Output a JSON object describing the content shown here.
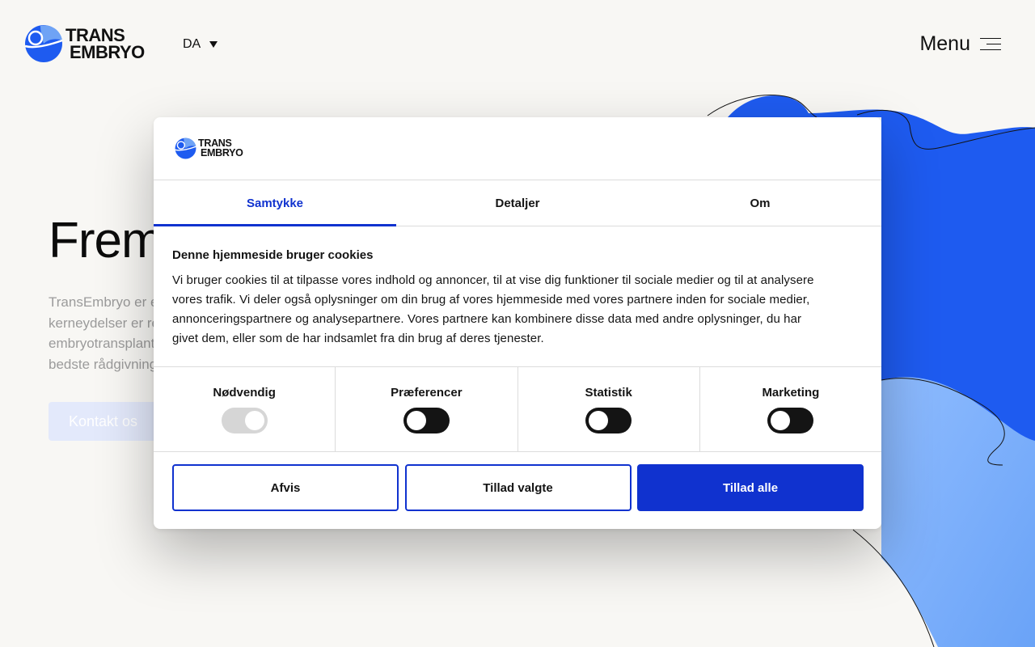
{
  "brand": {
    "logo_line1": "TRANS",
    "logo_line2": "EMBRYO",
    "primary_color": "#1032cf",
    "logo_blue": "#1e5bf0",
    "logo_light_blue": "#6fa3f5"
  },
  "header": {
    "language": "DA",
    "menu_label": "Menu"
  },
  "hero": {
    "title": "Frem",
    "text_lines": [
      "TransEmbryo er e",
      "kerneydelser er re",
      "embryotransplant",
      "bedste rådgivning"
    ],
    "cta_label": "Kontakt os"
  },
  "cookie_dialog": {
    "tabs": [
      {
        "label": "Samtykke",
        "active": true
      },
      {
        "label": "Detaljer",
        "active": false
      },
      {
        "label": "Om",
        "active": false
      }
    ],
    "title": "Denne hjemmeside bruger cookies",
    "body_lines": [
      "Vi bruger cookies til at tilpasse vores indhold og annoncer, til at vise dig funktioner til sociale medier og til at analysere",
      "vores trafik. Vi deler også oplysninger om din brug af vores hjemmeside med vores partnere inden for sociale medier,",
      "annonceringspartnere og analysepartnere. Vores partnere kan kombinere disse data med andre oplysninger, du har",
      "givet dem, eller som de har indsamlet fra din brug af deres tjenester."
    ],
    "categories": [
      {
        "label": "Nødvendig",
        "enabled": true,
        "locked": true
      },
      {
        "label": "Præferencer",
        "enabled": false,
        "locked": false
      },
      {
        "label": "Statistik",
        "enabled": false,
        "locked": false
      },
      {
        "label": "Marketing",
        "enabled": false,
        "locked": false
      }
    ],
    "buttons": {
      "reject": "Afvis",
      "allow_selected": "Tillad valgte",
      "allow_all": "Tillad alle"
    }
  }
}
